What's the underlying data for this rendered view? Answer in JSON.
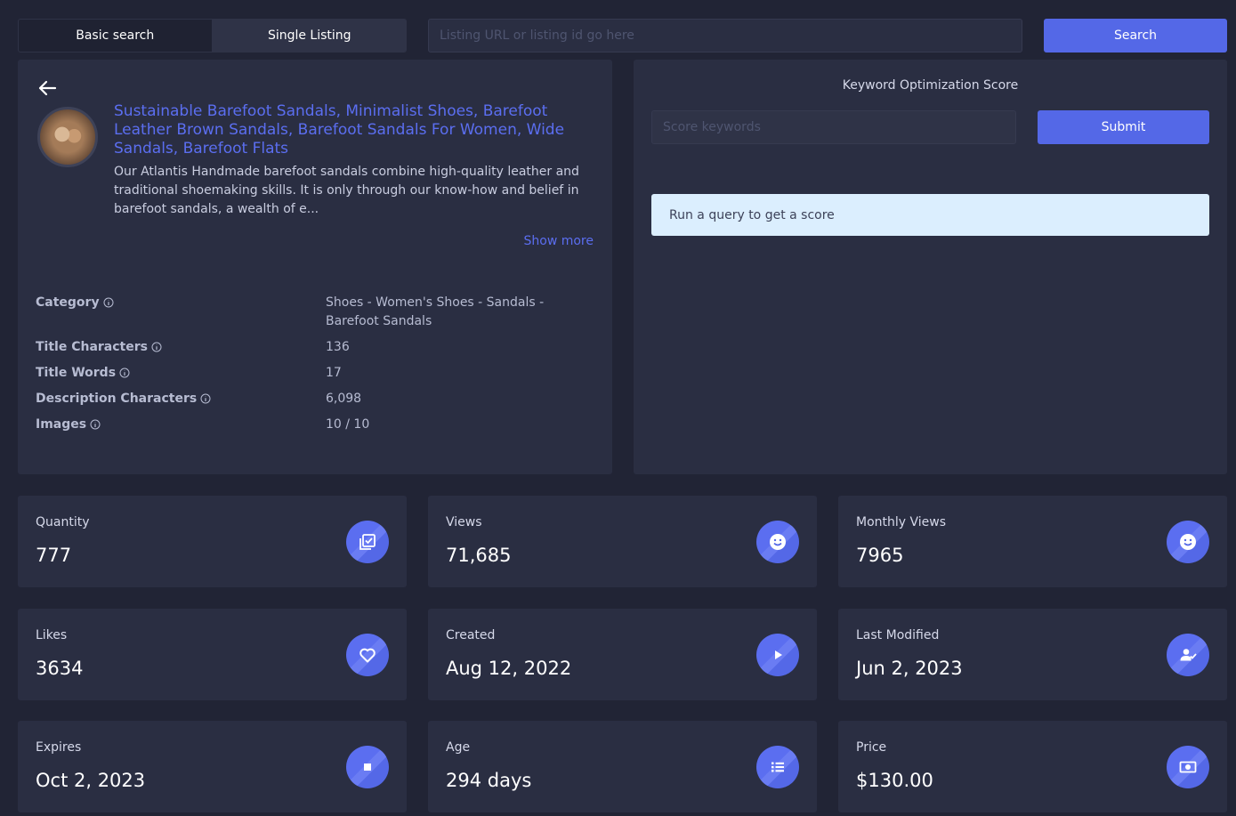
{
  "tabs": [
    {
      "label": "Basic search"
    },
    {
      "label": "Single Listing"
    }
  ],
  "search": {
    "placeholder": "Listing URL or listing id go here",
    "button_label": "Search"
  },
  "listing": {
    "title": "Sustainable Barefoot Sandals, Minimalist Shoes, Barefoot Leather Brown Sandals, Barefoot Sandals For Women, Wide Sandals, Barefoot Flats",
    "description": "Our Atlantis Handmade barefoot sandals combine high-quality leather and traditional shoemaking skills. It is only through our know-how and belief in barefoot sandals, a wealth of e...",
    "show_more": "Show more",
    "attributes": [
      {
        "label": "Category",
        "value": "Shoes - Women's Shoes - Sandals - Barefoot Sandals"
      },
      {
        "label": "Title Characters",
        "value": "136"
      },
      {
        "label": "Title Words",
        "value": "17"
      },
      {
        "label": "Description Characters",
        "value": "6,098"
      },
      {
        "label": "Images",
        "value": "10 / 10"
      }
    ]
  },
  "keyword_score": {
    "title": "Keyword Optimization Score",
    "placeholder": "Score keywords",
    "submit_label": "Submit",
    "message": "Run a query to get a score"
  },
  "stats": [
    {
      "label": "Quantity",
      "value": "777",
      "icon": "checklist-icon"
    },
    {
      "label": "Views",
      "value": "71,685",
      "icon": "smile-icon"
    },
    {
      "label": "Monthly Views",
      "value": "7965",
      "icon": "smile-icon"
    },
    {
      "label": "Likes",
      "value": "3634",
      "icon": "heart-icon"
    },
    {
      "label": "Created",
      "value": "Aug 12, 2022",
      "icon": "play-icon"
    },
    {
      "label": "Last Modified",
      "value": "Jun 2, 2023",
      "icon": "user-check-icon"
    },
    {
      "label": "Expires",
      "value": "Oct 2, 2023",
      "icon": "stop-icon"
    },
    {
      "label": "Age",
      "value": "294 days",
      "icon": "list-icon"
    },
    {
      "label": "Price",
      "value": "$130.00",
      "icon": "money-icon"
    }
  ]
}
